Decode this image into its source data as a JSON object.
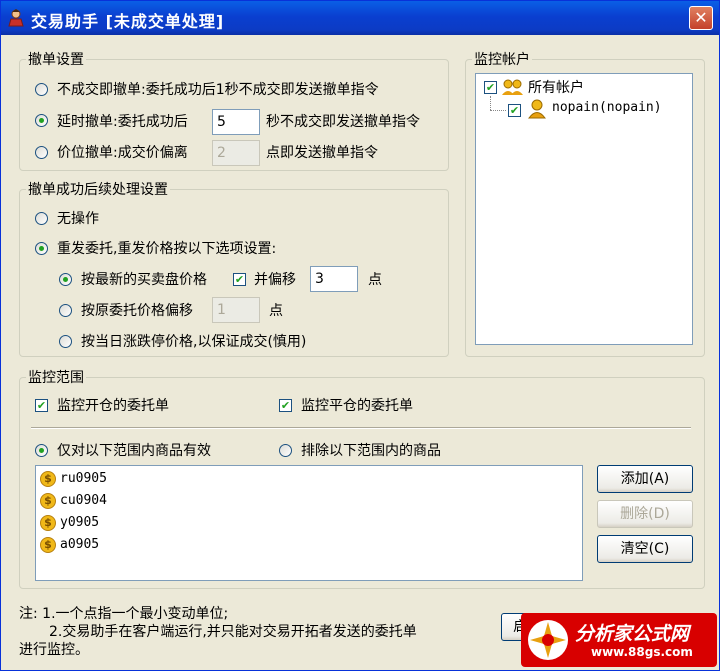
{
  "window": {
    "title": "交易助手 [未成交单处理]",
    "close_glyph": "✕"
  },
  "cancel_settings": {
    "legend": "撤单设置",
    "opt1": "不成交即撤单:委托成功后1秒不成交即发送撤单指令",
    "opt2_prefix": "延时撤单:委托成功后",
    "opt2_value": "5",
    "opt2_suffix": "秒不成交即发送撤单指令",
    "opt3_prefix": "价位撤单:成交价偏离",
    "opt3_value": "2",
    "opt3_suffix": "点即发送撤单指令"
  },
  "followup": {
    "legend": "撤单成功后续处理设置",
    "no_action": "无操作",
    "resubmit": "重发委托,重发价格按以下选项设置:",
    "latest_price": "按最新的买卖盘价格",
    "offset_check": "并偏移",
    "offset_value": "3",
    "unit1": "点",
    "orig_price": "按原委托价格偏移",
    "orig_value": "1",
    "unit2": "点",
    "limit_price": "按当日涨跌停价格,以保证成交(慎用)"
  },
  "accounts": {
    "legend": "监控帐户",
    "all": "所有帐户",
    "item": "nopain(nopain)"
  },
  "scope": {
    "legend": "监控范围",
    "open_orders": "监控开仓的委托单",
    "close_orders": "监控平仓的委托单",
    "include": "仅对以下范围内商品有效",
    "exclude": "排除以下范围内的商品",
    "products": [
      "ru0905",
      "cu0904",
      "y0905",
      "a0905"
    ],
    "coin_glyph": "$"
  },
  "buttons": {
    "add": "添加(A)",
    "delete": "删除(D)",
    "clear": "清空(C)",
    "start": "启动监控(S)"
  },
  "note": {
    "line1": "注: 1.一个点指一个最小变动单位;",
    "line2": "2.交易助手在客户端运行,并只能对交易开拓者发送的委托单",
    "line3": "进行监控。"
  },
  "watermark": {
    "brand": "分析家公式网",
    "url": "www.88gs.com"
  },
  "colors": {
    "title_bar": "#0a46d8",
    "window_bg": "#ece9d8",
    "watermark_bg": "#d80000"
  }
}
